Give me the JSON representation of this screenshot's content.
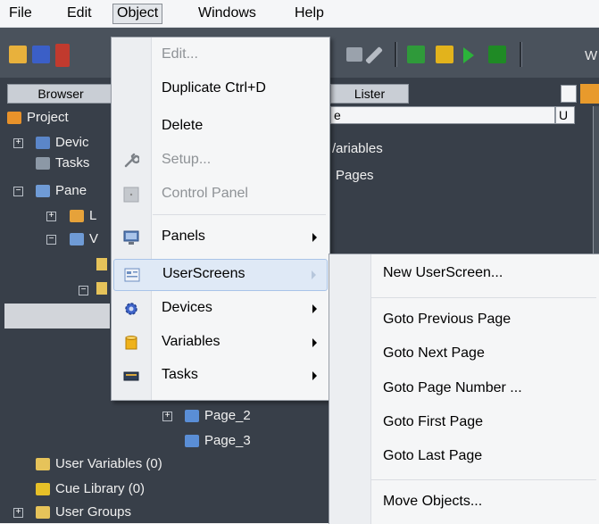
{
  "menubar": {
    "items": [
      {
        "label": "File"
      },
      {
        "label": "Edit"
      },
      {
        "label": "Object"
      },
      {
        "label": "Windows"
      },
      {
        "label": "Help"
      }
    ]
  },
  "toolbar": {
    "trailing_text": "W"
  },
  "browser": {
    "header": "Browser",
    "tree": [
      {
        "label": "Project"
      },
      {
        "label": "Devic"
      },
      {
        "label": "Tasks"
      },
      {
        "label": "Pane"
      },
      {
        "label": "L"
      },
      {
        "label": "V"
      },
      {
        "label": "Page_2"
      },
      {
        "label": "Page_3"
      },
      {
        "label": "User Variables (0)"
      },
      {
        "label": "Cue Library (0)"
      },
      {
        "label": "User Groups"
      }
    ]
  },
  "lister": {
    "header": "Lister",
    "columns": [
      "e",
      "U"
    ],
    "rows": [
      "/ariables",
      "Pages"
    ]
  },
  "object_menu": {
    "items": [
      {
        "label": "Edit...",
        "icon": "blank",
        "enabled": false
      },
      {
        "label": "Duplicate Ctrl+D",
        "icon": "blank",
        "enabled": true
      },
      {
        "label": "Delete",
        "icon": "blank",
        "enabled": true
      },
      {
        "label": "Setup...",
        "icon": "wrench-icon",
        "enabled": false
      },
      {
        "label": "Control Panel",
        "icon": "control-panel-icon",
        "enabled": false
      },
      {
        "label": "Panels",
        "icon": "monitor-icon",
        "enabled": true,
        "submenu": true
      },
      {
        "label": "UserScreens",
        "icon": "userscreen-icon",
        "enabled": true,
        "submenu": true,
        "highlighted": true
      },
      {
        "label": "Devices",
        "icon": "gear-icon",
        "enabled": true,
        "submenu": true
      },
      {
        "label": "Variables",
        "icon": "cylinder-icon",
        "enabled": true,
        "submenu": true
      },
      {
        "label": "Tasks",
        "icon": "tasks-icon",
        "enabled": true,
        "submenu": true
      }
    ]
  },
  "userscreens_submenu": {
    "items": [
      {
        "label": "New UserScreen..."
      },
      {
        "label": "Goto Previous Page"
      },
      {
        "label": "Goto Next Page"
      },
      {
        "label": "Goto Page Number ..."
      },
      {
        "label": "Goto First Page"
      },
      {
        "label": "Goto Last Page"
      },
      {
        "label": "Move Objects..."
      }
    ]
  },
  "colors": {
    "menubar_bg": "#f5f6f8",
    "app_bg": "#383f49",
    "menu_bg": "#f5f6f7",
    "highlight": "#dfe9f6",
    "disabled_text": "#8e9296"
  }
}
